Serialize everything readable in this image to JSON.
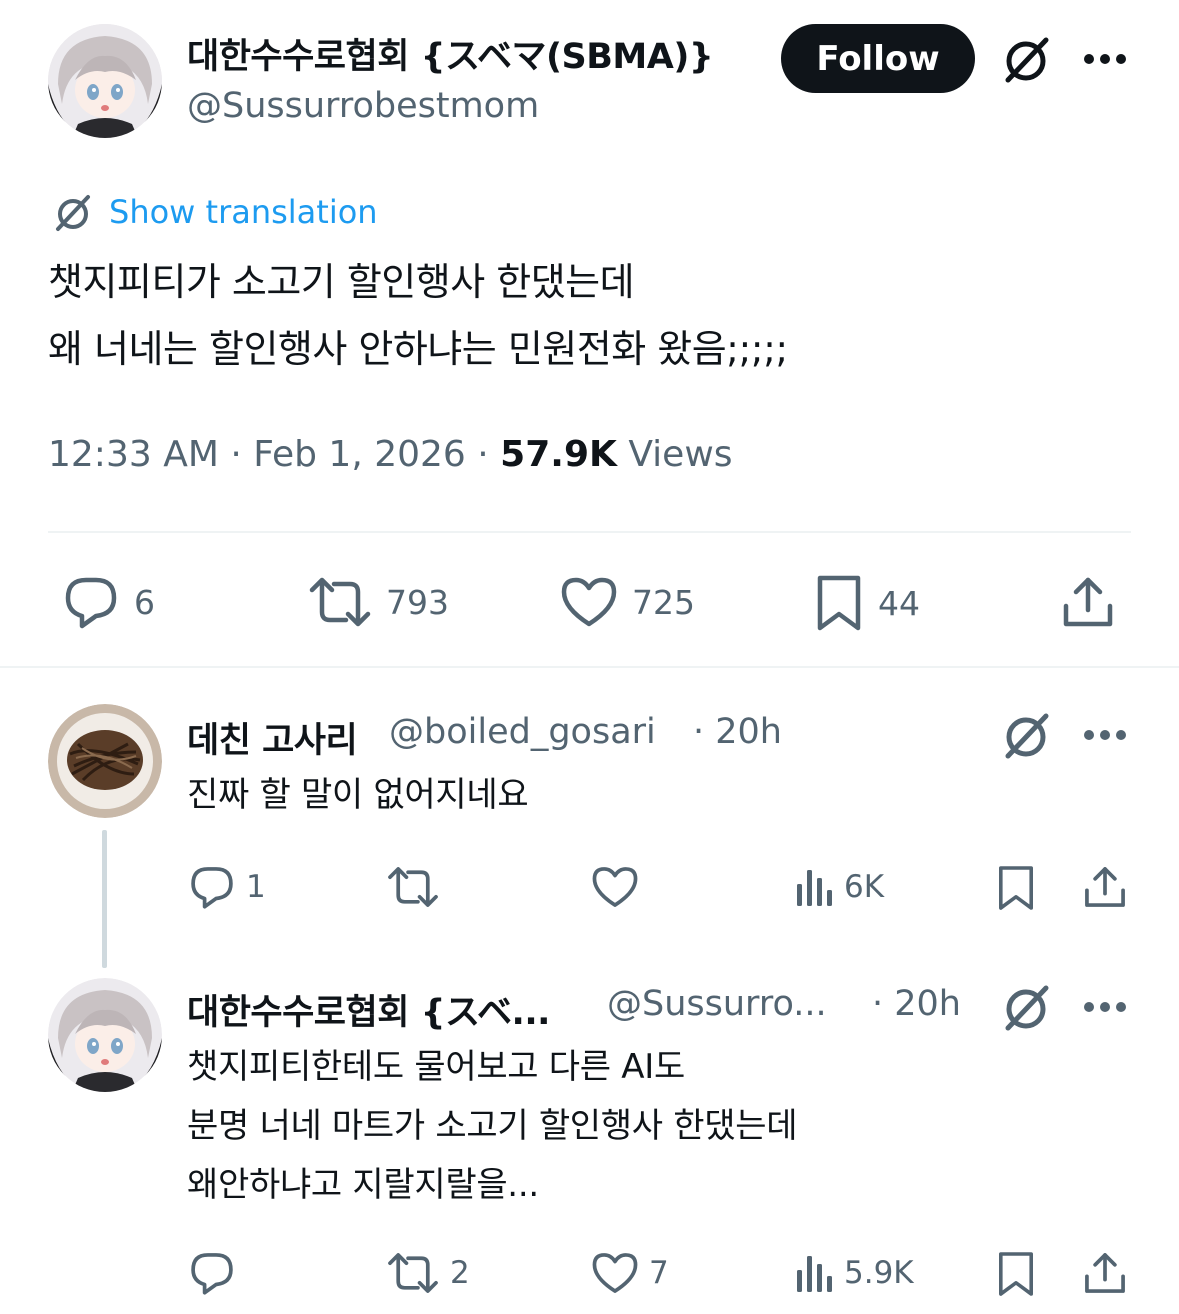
{
  "main_tweet": {
    "author_name": "대한수수로협회 {スベマ(SBMA)}",
    "author_handle": "@Sussurrobestmom",
    "follow_label": "Follow",
    "translate_label": "Show translation",
    "text_lines": [
      "챗지피티가 소고기 할인행사 한댔는데",
      "왜 너네는 할인행사 안하냐는 민원전화 왔음;;;;;"
    ],
    "time": "12:33 AM",
    "date": "Feb 1, 2026",
    "views_count": "57.9K",
    "views_label": "Views",
    "replies": "6",
    "reposts": "793",
    "likes": "725",
    "bookmarks": "44"
  },
  "replies": [
    {
      "author_name": "데친 고사리",
      "author_handle": "@boiled_gosari",
      "time": "· 20h",
      "text_lines": [
        "진짜 할 말이 없어지네요"
      ],
      "replies": "1",
      "reposts": "",
      "likes": "",
      "views": "6K"
    },
    {
      "author_name": "대한수수로협회 {スベ...",
      "author_handle": "@Sussurro...",
      "time": "· 20h",
      "text_lines": [
        "챗지피티한테도 물어보고 다른 AI도",
        "분명 너네 마트가 소고기 할인행사 한댔는데",
        "왜안하냐고 지랄지랄을..."
      ],
      "replies": "",
      "reposts": "2",
      "likes": "7",
      "views": "5.9K"
    }
  ],
  "icons": {
    "translate": "grok-slash-icon",
    "more": "more-dots-icon",
    "reply": "reply-bubble-icon",
    "repost": "repost-arrows-icon",
    "like": "heart-icon",
    "bookmark": "bookmark-icon",
    "share": "share-upload-icon",
    "views": "views-bars-icon"
  },
  "colors": {
    "text": "#0f1419",
    "muted": "#536471",
    "link": "#1d9bf0",
    "divider": "#eff3f4",
    "thread_line": "#cfd9de",
    "button": "#0f1419"
  }
}
